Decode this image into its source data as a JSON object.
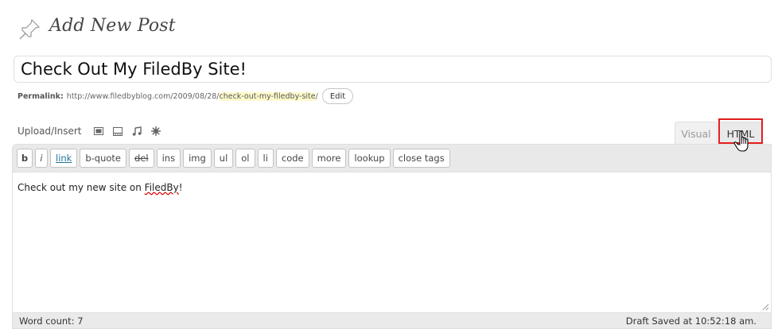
{
  "page": {
    "title": "Add New Post"
  },
  "post": {
    "title_value": "Check Out My FiledBy Site!",
    "permalink_label": "Permalink:",
    "permalink_base": "http://www.filedbyblog.com/2009/08/28/",
    "permalink_slug": "check-out-my-filedby-site",
    "permalink_trailing": "/",
    "edit_button": "Edit"
  },
  "media": {
    "label": "Upload/Insert",
    "icons": [
      "image-icon",
      "video-icon",
      "audio-icon",
      "media-icon"
    ]
  },
  "editor_tabs": {
    "visual": "Visual",
    "html": "HTML",
    "active": "html"
  },
  "quicktags": {
    "b": "b",
    "i": "i",
    "link": "link",
    "b_quote": "b-quote",
    "del": "del",
    "ins": "ins",
    "img": "img",
    "ul": "ul",
    "ol": "ol",
    "li": "li",
    "code": "code",
    "more": "more",
    "lookup": "lookup",
    "close_tags": "close tags"
  },
  "content": {
    "text_before": "Check out my new site on ",
    "text_misspelled": "FiledBy",
    "text_after": "!"
  },
  "status": {
    "word_count": "Word count: 7",
    "draft_saved": "Draft Saved at 10:52:18 am."
  },
  "colors": {
    "highlight_box": "#e41d1d",
    "link": "#21759b",
    "slug_highlight": "#fffbcc"
  }
}
